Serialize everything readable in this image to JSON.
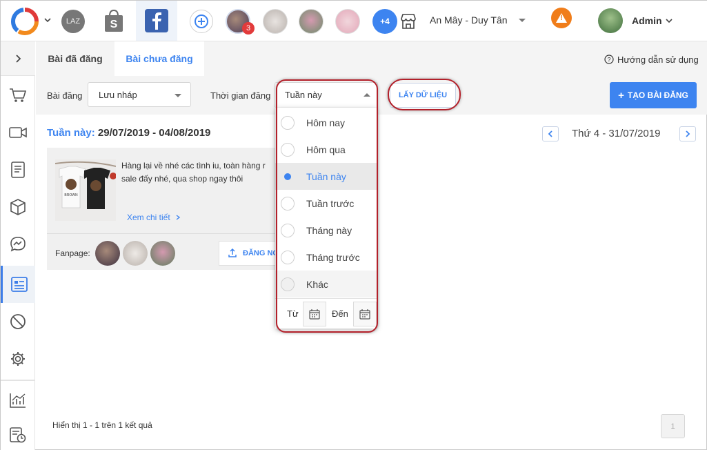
{
  "topbar": {
    "store_name": "An Mây - Duy Tân",
    "user_name": "Admin",
    "lazada_label": "LAZ",
    "extra_pages_count": "+4",
    "notification_count": "3",
    "warning_symbol": "!"
  },
  "tabs": [
    {
      "label": "Bài đã đăng"
    },
    {
      "label": "Bài chưa đăng"
    }
  ],
  "help_label": "Hướng dẫn sử dụng",
  "filters": {
    "post_label": "Bài đăng",
    "post_value": "Lưu nháp",
    "time_label": "Thời gian đăng",
    "time_value": "Tuần này",
    "fetch_button": "LẤY DỮ LIỆU",
    "create_button": "TẠO BÀI ĐĂNG"
  },
  "range": {
    "prefix": "Tuần này:",
    "dates": "29/07/2019 - 04/08/2019",
    "current_day": "Thứ 4 - 31/07/2019"
  },
  "post": {
    "text_line1": "Hàng lại về nhé các tình iu, toàn hàng r",
    "text_line2": "sale đấy nhé, qua shop ngay thôi",
    "detail_link": "Xem chi tiết",
    "fanpage_label": "Fanpage:",
    "post_now_button": "ĐĂNG NG",
    "shirt_brand": "BROWN"
  },
  "dropdown": {
    "options": [
      {
        "label": "Hôm nay",
        "selected": false
      },
      {
        "label": "Hôm qua",
        "selected": false
      },
      {
        "label": "Tuần này",
        "selected": true
      },
      {
        "label": "Tuần trước",
        "selected": false
      },
      {
        "label": "Tháng này",
        "selected": false
      },
      {
        "label": "Tháng trước",
        "selected": false
      },
      {
        "label": "Khác",
        "selected": false
      }
    ],
    "from_label": "Từ",
    "to_label": "Đến"
  },
  "footer": {
    "summary": "Hiển thị 1 - 1 trên 1 kết quả",
    "page": "1"
  },
  "icons": {
    "sidebar": [
      "chevron-right-icon",
      "cart-icon",
      "video-icon",
      "document-icon",
      "box-icon",
      "messenger-icon",
      "post-list-icon",
      "ban-icon",
      "gear-icon",
      "chart-icon",
      "calendar-clock-icon"
    ]
  },
  "colors": {
    "accent": "#3d84f0",
    "highlight_ring": "#b3202a",
    "warning": "#f07d1a",
    "facebook": "#3b63b0",
    "badge": "#e23b3b"
  }
}
